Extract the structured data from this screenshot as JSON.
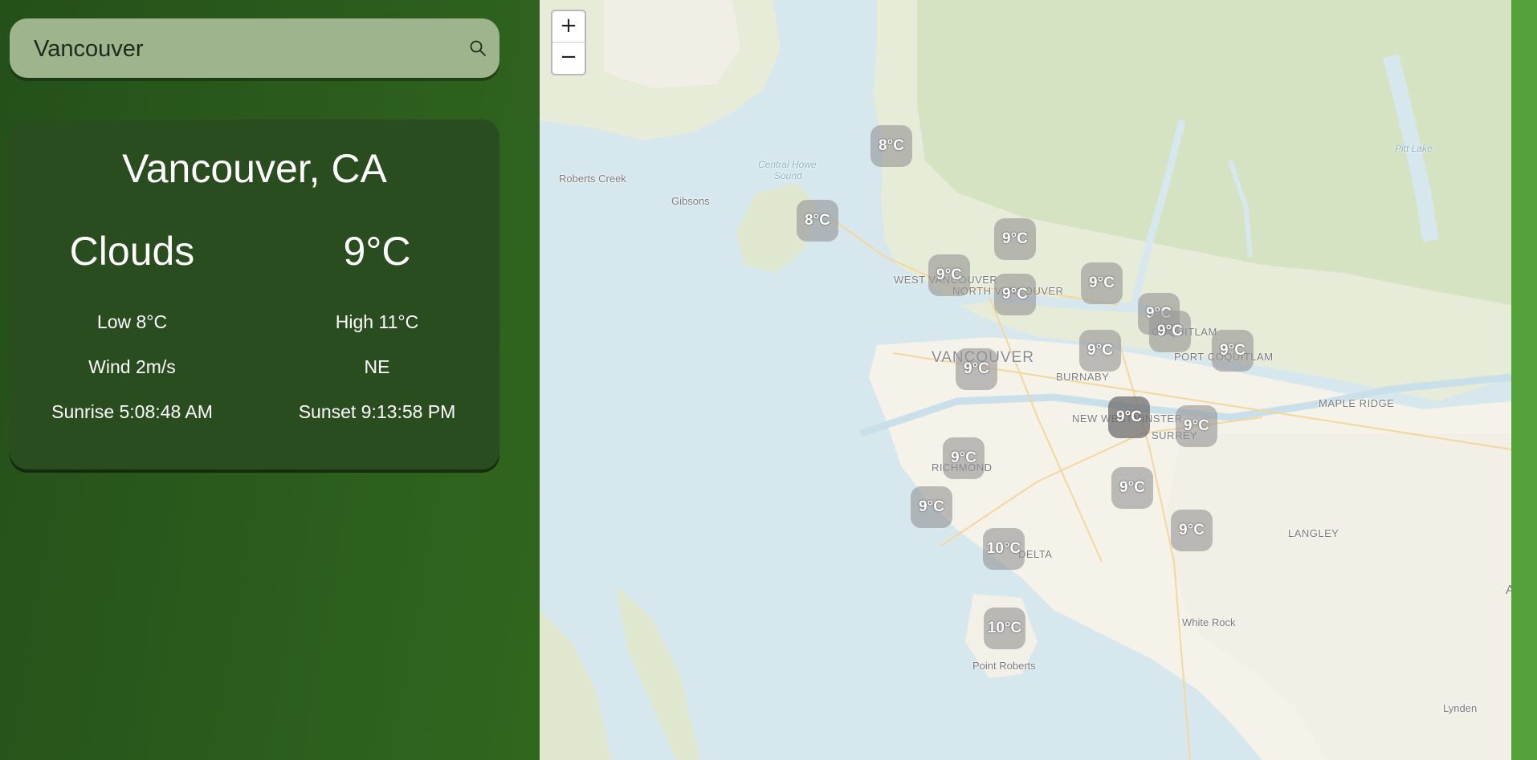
{
  "search": {
    "value": "Vancouver"
  },
  "weather": {
    "city": "Vancouver, CA",
    "condition": "Clouds",
    "temperature": "9°C",
    "low": "Low 8°C",
    "high": "High 11°C",
    "wind": "Wind 2m/s",
    "wind_direction": "NE",
    "sunrise": "Sunrise 5:08:48 AM",
    "sunset": "Sunset 9:13:58 PM"
  },
  "map": {
    "zoom_in": "+",
    "zoom_out": "−",
    "labels": {
      "roberts_creek": "Roberts Creek",
      "gibsons": "Gibsons",
      "central_howe_1": "Central Howe",
      "central_howe_2": "Sound",
      "pitt_lake": "Pitt Lake",
      "west_vancouver": "WEST VANCOUVER",
      "north_vancouver": "NORTH VANCOUVER",
      "vancouver": "VANCOUVER",
      "burnaby": "BURNABY",
      "coquitlam": "COQUITLAM",
      "port_coquitlam": "PORT COQUITLAM",
      "maple_ridge": "MAPLE RIDGE",
      "new_westminster": "NEW WESTMINSTER",
      "surrey": "SURREY",
      "richmond": "RICHMOND",
      "delta": "DELTA",
      "langley": "LANGLEY",
      "white_rock": "White Rock",
      "point_roberts": "Point Roberts",
      "lynden": "Lynden",
      "edge_a": "A"
    },
    "markers": [
      "8°C",
      "8°C",
      "9°C",
      "9°C",
      "9°C",
      "9°C",
      "9°C",
      "9°C",
      "9°C",
      "9°C",
      "9°C",
      "9°C",
      "9°C",
      "9°C",
      "9°C",
      "9°C",
      "9°C",
      "10°C",
      "10°C"
    ]
  }
}
